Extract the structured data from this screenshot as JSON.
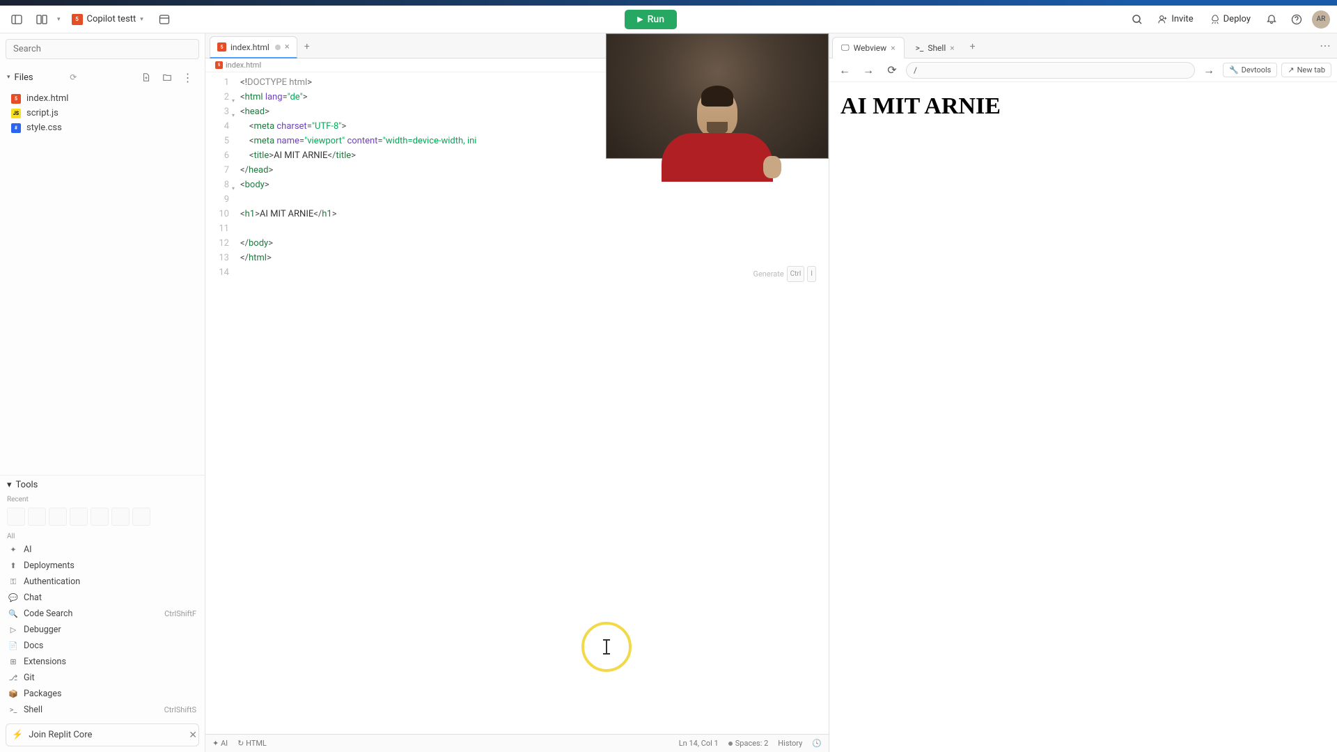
{
  "topbar": {
    "repl_name": "Copilot testt",
    "run_label": "Run",
    "invite_label": "Invite",
    "deploy_label": "Deploy",
    "avatar_initials": "AR"
  },
  "sidebar": {
    "search_placeholder": "Search",
    "files_label": "Files",
    "files": [
      {
        "name": "index.html",
        "type": "html"
      },
      {
        "name": "script.js",
        "type": "js"
      },
      {
        "name": "style.css",
        "type": "css"
      }
    ],
    "tools_label": "Tools",
    "recent_label": "Recent",
    "all_label": "All",
    "tools": [
      {
        "name": "AI",
        "icon": "✦",
        "shortcut": ""
      },
      {
        "name": "Deployments",
        "icon": "⬆",
        "shortcut": ""
      },
      {
        "name": "Authentication",
        "icon": "⚿",
        "shortcut": ""
      },
      {
        "name": "Chat",
        "icon": "💬",
        "shortcut": ""
      },
      {
        "name": "Code Search",
        "icon": "🔍",
        "shortcut": "CtrlShiftF"
      },
      {
        "name": "Debugger",
        "icon": "▷",
        "shortcut": ""
      },
      {
        "name": "Docs",
        "icon": "📄",
        "shortcut": ""
      },
      {
        "name": "Extensions",
        "icon": "⊞",
        "shortcut": ""
      },
      {
        "name": "Git",
        "icon": "⎇",
        "shortcut": ""
      },
      {
        "name": "Packages",
        "icon": "📦",
        "shortcut": ""
      },
      {
        "name": "Shell",
        "icon": ">_",
        "shortcut": "CtrlShiftS"
      }
    ],
    "join_label": "Join Replit Core"
  },
  "editor": {
    "tab_name": "index.html",
    "breadcrumb": "index.html",
    "generate_label": "Generate",
    "generate_kbd1": "Ctrl",
    "generate_kbd2": "I",
    "code_lines": [
      {
        "n": 1,
        "html": "<span class='t-punc'>&lt;!</span><span class='t-doctype'>DOCTYPE html</span><span class='t-punc'>&gt;</span>"
      },
      {
        "n": 2,
        "fold": true,
        "html": "<span class='t-punc'>&lt;</span><span class='t-tag'>html</span> <span class='t-attr'>lang</span><span class='t-punc'>=</span><span class='t-str'>\"de\"</span><span class='t-punc'>&gt;</span>"
      },
      {
        "n": 3,
        "fold": true,
        "html": "<span class='t-punc'>&lt;</span><span class='t-tag'>head</span><span class='t-punc'>&gt;</span>"
      },
      {
        "n": 4,
        "html": "    <span class='t-punc'>&lt;</span><span class='t-tag'>meta</span> <span class='t-attr'>charset</span><span class='t-punc'>=</span><span class='t-str'>\"UTF-8\"</span><span class='t-punc'>&gt;</span>"
      },
      {
        "n": 5,
        "html": "    <span class='t-punc'>&lt;</span><span class='t-tag'>meta</span> <span class='t-attr'>name</span><span class='t-punc'>=</span><span class='t-str'>\"viewport\"</span> <span class='t-attr'>content</span><span class='t-punc'>=</span><span class='t-str'>\"width=device-width, ini</span>"
      },
      {
        "n": 6,
        "html": "    <span class='t-punc'>&lt;</span><span class='t-tag'>title</span><span class='t-punc'>&gt;</span><span class='t-text'>AI MIT ARNIE</span><span class='t-punc'>&lt;/</span><span class='t-tag'>title</span><span class='t-punc'>&gt;</span>"
      },
      {
        "n": 7,
        "html": "<span class='t-punc'>&lt;/</span><span class='t-tag'>head</span><span class='t-punc'>&gt;</span>"
      },
      {
        "n": 8,
        "fold": true,
        "html": "<span class='t-punc'>&lt;</span><span class='t-tag'>body</span><span class='t-punc'>&gt;</span>"
      },
      {
        "n": 9,
        "html": ""
      },
      {
        "n": 10,
        "html": "<span class='t-punc'>&lt;</span><span class='t-tag'>h1</span><span class='t-punc'>&gt;</span><span class='t-text'>AI MIT ARNIE</span><span class='t-punc'>&lt;/</span><span class='t-tag'>h1</span><span class='t-punc'>&gt;</span>"
      },
      {
        "n": 11,
        "html": ""
      },
      {
        "n": 12,
        "html": "<span class='t-punc'>&lt;/</span><span class='t-tag'>body</span><span class='t-punc'>&gt;</span>"
      },
      {
        "n": 13,
        "html": "<span class='t-punc'>&lt;/</span><span class='t-tag'>html</span><span class='t-punc'>&gt;</span>"
      },
      {
        "n": 14,
        "html": ""
      }
    ]
  },
  "statusbar": {
    "ai_label": "AI",
    "lang_label": "HTML",
    "cursor_pos": "Ln 14, Col 1",
    "spaces": "Spaces: 2",
    "history": "History"
  },
  "preview": {
    "tabs": [
      {
        "label": "Webview",
        "icon": "🖵",
        "active": true
      },
      {
        "label": "Shell",
        "icon": ">_",
        "active": false
      }
    ],
    "url_value": "/",
    "devtools_label": "Devtools",
    "newtab_label": "New tab",
    "heading": "AI MIT ARNIE"
  }
}
